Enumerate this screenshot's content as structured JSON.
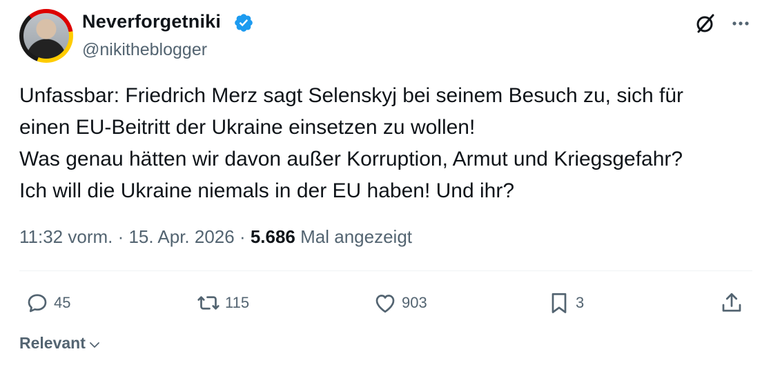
{
  "author": {
    "display_name": "Neverforgetniki",
    "handle": "@nikitheblogger",
    "verified": true
  },
  "tweet": {
    "text": "Unfassbar: Friedrich Merz sagt Selenskyj bei seinem Besuch zu, sich für\neinen EU-Beitritt der Ukraine einsetzen zu wollen!\nWas genau hätten wir davon außer Korruption, Armut und Kriegsgefahr?\nIch will die Ukraine niemals in der EU haben! Und ihr?",
    "time": "11:32 vorm.",
    "separator": " · ",
    "date": "15. Apr. 2026",
    "views_count": "5.686",
    "views_label": "Mal angezeigt"
  },
  "actions": {
    "replies": "45",
    "reposts": "115",
    "likes": "903",
    "bookmarks": "3"
  },
  "sort": {
    "label": "Relevant"
  },
  "colors": {
    "text": "#0f1419",
    "secondary": "#536471",
    "verified_blue": "#1d9bf0",
    "divider": "#eff3f4"
  },
  "icons": {
    "avatar": "profile-photo",
    "verified": "verified-badge-icon",
    "grok": "grok-icon",
    "more": "more-dots-icon",
    "reply": "reply-bubble-icon",
    "repost": "repost-arrows-icon",
    "like": "heart-icon",
    "bookmark": "bookmark-icon",
    "share": "share-upload-icon",
    "chevron": "chevron-down-icon"
  }
}
